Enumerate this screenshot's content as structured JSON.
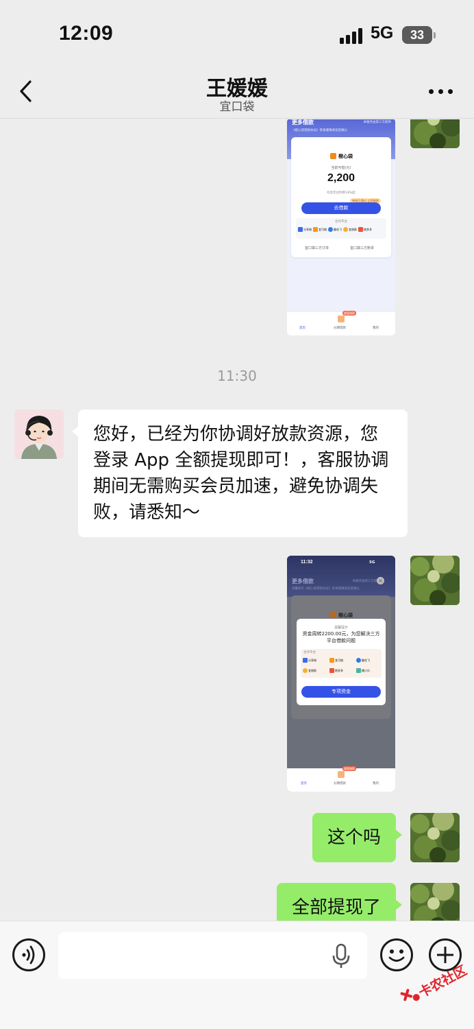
{
  "status_bar": {
    "time": "12:09",
    "network": "5G",
    "battery": "33"
  },
  "header": {
    "title": "王媛媛",
    "subtitle": "宜口袋"
  },
  "screenshot_1": {
    "section_title": "更多借款",
    "section_note": "本服务由第三方提供",
    "notice": "《橙心袋借款协议》等请谨慎阅读后确认",
    "brand": "橙心袋",
    "amount_label": "当前可借(元)",
    "amount": "2,200",
    "rate_note": "综合年化利率18%起",
    "tag": "审核已通过 立即借款",
    "button": "去借款",
    "partner_title": "合作平台",
    "partners": [
      "分享借",
      "宜可借",
      "趣花飞",
      "宜借款",
      "桃多多"
    ],
    "link_left": "宜口袋三方订单",
    "link_right": "宜口袋三方账单",
    "tabs": [
      "首页",
      "分期借款",
      "我的"
    ],
    "badge": "超值借款"
  },
  "timestamp_1": "11:30",
  "message_agent": "您好，已经为你协调好放款资源，您登录 App 全额提现即可！，客服协调期间无需购买会员加速，避免协调失败，请悉知～",
  "screenshot_2": {
    "time": "11:32",
    "status": "5G",
    "section_title": "更多借款",
    "section_note": "本服务由第三方提供",
    "notice": "温馨提示《橙心袋借款协议》等请谨慎阅读后确认",
    "brand": "橙心袋",
    "dialog_title": "温馨提示",
    "dialog_text": "资金周转2200.00元，为您解决三方平台借款问题",
    "partner_title": "合作平台",
    "partners": [
      "分享借",
      "宜可借",
      "趣花飞",
      "宜借款",
      "桃多多",
      "橘小乐"
    ],
    "button": "专项资金",
    "tabs": [
      "首页",
      "分期借款",
      "我的"
    ],
    "badge": "超值借款"
  },
  "message_self_1": "这个吗",
  "message_self_2": "全部提现了",
  "watermark": "卡农社区",
  "colors": {
    "bubble_self": "#95ec69",
    "bubble_other": "#ffffff",
    "background": "#ededed",
    "app_accent": "#3552e6"
  }
}
